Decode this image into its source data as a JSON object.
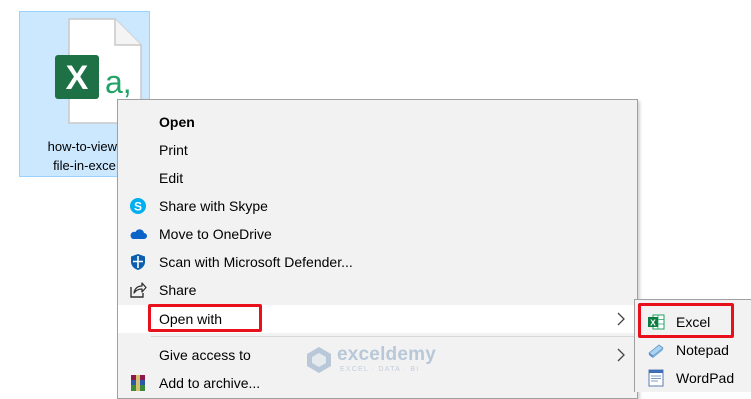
{
  "desktop_file": {
    "name_line1": "how-to-view-",
    "name_line2": "file-in-exce",
    "icon": "excel-csv-file-icon",
    "badge_letter": "X",
    "badge_text": "a,"
  },
  "context_menu": {
    "items": [
      {
        "label": "Open",
        "bold": true,
        "icon": null
      },
      {
        "label": "Print",
        "icon": null
      },
      {
        "label": "Edit",
        "icon": null
      },
      {
        "label": "Share with Skype",
        "icon": "skype-icon"
      },
      {
        "label": "Move to OneDrive",
        "icon": "onedrive-icon"
      },
      {
        "label": "Scan with Microsoft Defender...",
        "icon": "defender-shield-icon"
      },
      {
        "label": "Share",
        "icon": "share-icon"
      },
      {
        "label": "Open with",
        "icon": null,
        "submenu": true,
        "highlighted": true
      },
      {
        "label": "Give access to",
        "icon": null,
        "submenu": true
      },
      {
        "label": "Add to archive...",
        "icon": "winrar-icon"
      }
    ]
  },
  "open_with_submenu": {
    "items": [
      {
        "label": "Excel",
        "icon": "excel-icon",
        "highlighted": true
      },
      {
        "label": "Notepad",
        "icon": "notepad-icon"
      },
      {
        "label": "WordPad",
        "icon": "wordpad-icon"
      }
    ]
  },
  "watermark": {
    "name": "exceldemy",
    "tagline": "EXCEL · DATA · BI"
  },
  "colors": {
    "selection": "#cce8ff",
    "menu_bg": "#f2f2f2",
    "highlight_red": "#e8101b",
    "excel_green": "#21a366"
  }
}
